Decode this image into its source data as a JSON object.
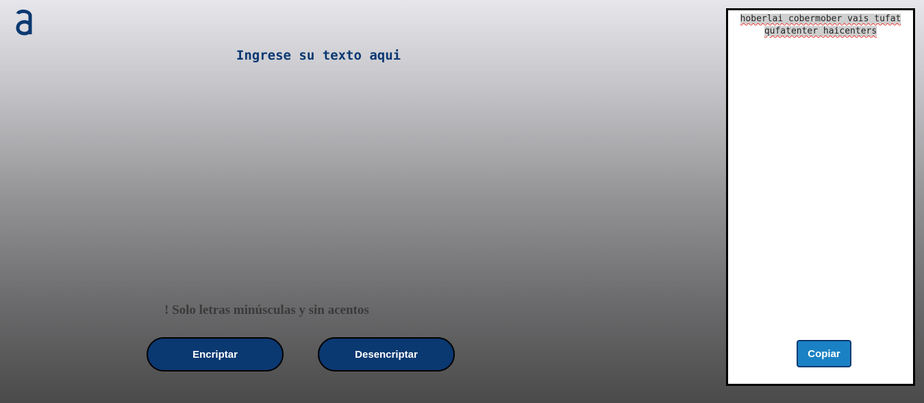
{
  "logo": {
    "icon": "alura-logo-icon",
    "color": "#0a3871"
  },
  "input": {
    "placeholder": "Ingrese su texto aqui",
    "value": ""
  },
  "warning": {
    "text": "! Solo letras minúsculas y sin acentos"
  },
  "buttons": {
    "encrypt_label": "Encriptar",
    "decrypt_label": "Desencriptar"
  },
  "output": {
    "text": "hoberlai cobermober vais tufat qufatenter haicenters",
    "copy_label": "Copiar"
  },
  "colors": {
    "primary": "#0a3871",
    "copy_button": "#1a82c4",
    "warning_text": "#3a3a3a"
  }
}
